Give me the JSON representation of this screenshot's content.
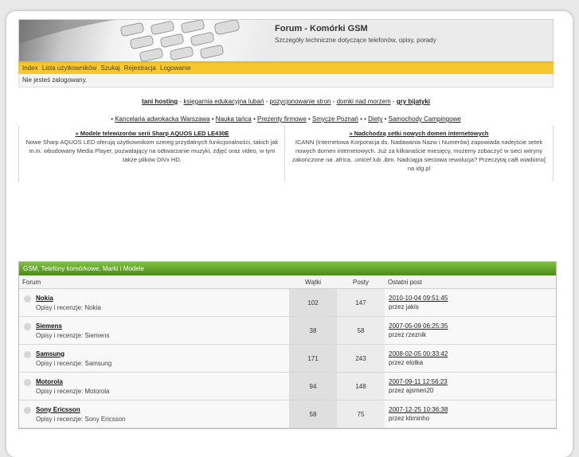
{
  "site": {
    "title": "Forum - Komórki GSM",
    "subtitle": "Szczegóły techniczne dotyczące telefonów, opisy, porady"
  },
  "nav": [
    "Index",
    "Lista użytkowników",
    "Szukaj",
    "Rejestracja",
    "Logowanie"
  ],
  "login_status": "Nie jesteś zalogowany.",
  "links_row1": [
    {
      "text": "tani hosting",
      "bold": true
    },
    {
      "text": "księgarnia edukacyjna lubań",
      "bold": false
    },
    {
      "text": "pozycjonowanie stron",
      "bold": false
    },
    {
      "text": "domki nad morzem",
      "bold": false
    },
    {
      "text": "gry bijatyki",
      "bold": true
    }
  ],
  "links_row2": [
    "Kancelaria adwokacka Warszawa",
    "Nauka tańca",
    "Prezenty firmowe",
    "Smycze Poznań",
    "",
    "Diety",
    "Samochody Campingowe"
  ],
  "ads": [
    {
      "title": "» Modele telewizorów serii Sharp AQUOS LED LE430E",
      "body": "Nowe Sharp AQUOS LED oferują użytkownikom szereg przydatnych funkcjonalności, takich jak m.in. wbudowany Media Player, pozwalający na odtwarzanie muzyki, zdjęć oraz video, w tym także plików DiVx HD."
    },
    {
      "title": "» Nadchodzą setki nowych domen internetowych",
      "body": "ICANN (Internetowa Korporacja ds. Nadawania Nazw i Numerów) zapowiada nadejście setek nowych domen internetowych. Już za kilkanaście miesięcy, możemy zobaczyć w sieci witryny zakończone na .africa, .unicef lub .ibm. Nadciąga sieciowa rewolucja? Przeczytaj caB wiadomo[ na idg.pl"
    }
  ],
  "forum": {
    "category": "GSM, Telefony komórkowe, Marki i Modele",
    "columns": {
      "forum": "Forum",
      "topics": "Wątki",
      "posts": "Posty",
      "last_post": "Ostatni post"
    },
    "rows": [
      {
        "name": "Nokia",
        "desc": "Opisy i recenzje: Nokia",
        "topics": "102",
        "posts": "147",
        "date": "2010-10-04 09:51:45",
        "by": "przez jakis"
      },
      {
        "name": "Siemens",
        "desc": "Opisy i recenzje: Siemens",
        "topics": "38",
        "posts": "58",
        "date": "2007-05-09 06:25:35",
        "by": "przez rzeznik"
      },
      {
        "name": "Samsung",
        "desc": "Opisy i recenzje: Samsung",
        "topics": "171",
        "posts": "243",
        "date": "2008-02-05 00:33:42",
        "by": "przez elotka"
      },
      {
        "name": "Motorola",
        "desc": "Opisy i recenzje: Motorola",
        "topics": "94",
        "posts": "148",
        "date": "2007-09-11 12:56:23",
        "by": "przez ajsmen20"
      },
      {
        "name": "Sony Ericsson",
        "desc": "Opisy i recenzje: Sony Ericsson",
        "topics": "58",
        "posts": "75",
        "date": "2007-12-25 10:36:38",
        "by": "przez kliminho"
      }
    ]
  },
  "colors": {
    "accent_bar": "#f7c82e",
    "forum_header": "#5e9d26",
    "page_bg": "#e9e9e9"
  }
}
